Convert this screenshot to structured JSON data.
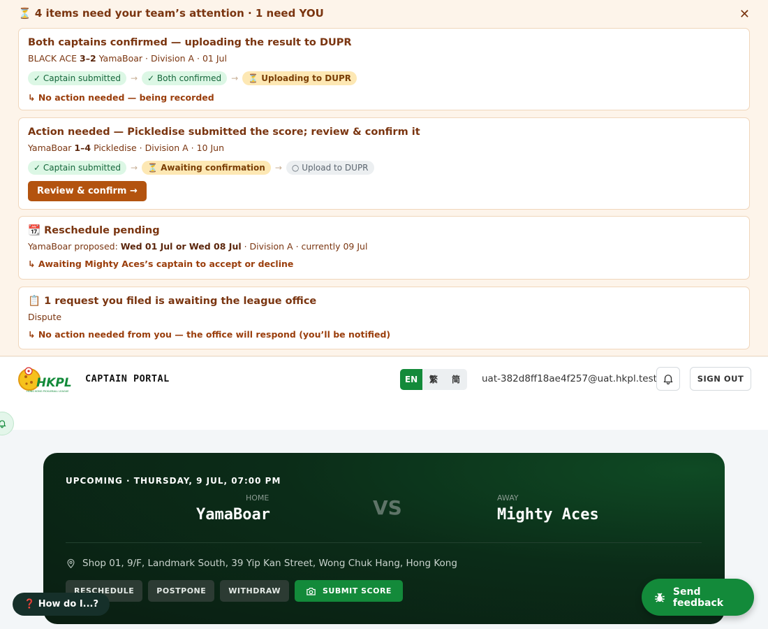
{
  "attention": {
    "headline": "⏳ 4 items need your team’s attention · 1 need YOU",
    "close_glyph": "✕",
    "cards": [
      {
        "title": "Both captains confirmed — uploading the result to DUPR",
        "home": "BLACK ACE",
        "score": "3–2",
        "away": "YamaBoar",
        "meta": " · Division A · 01 Jul",
        "steps": [
          "✓ Captain submitted",
          "✓ Both confirmed",
          "⏳ Uploading to DUPR"
        ],
        "note": "↳ No action needed — being recorded"
      },
      {
        "title": "Action needed — Pickledise submitted the score; review & confirm it",
        "home": "YamaBoar",
        "score": "1–4",
        "away": "Pickledise",
        "meta": " · Division A · 10 Jun",
        "steps": [
          "✓ Captain submitted",
          "⏳ Awaiting confirmation",
          "○ Upload to DUPR"
        ],
        "button": "Review & confirm →"
      },
      {
        "title": "📆 Reschedule pending",
        "proposer": "YamaBoar proposed: ",
        "proposed_dates": "Wed 01 Jul or Wed 08 Jul",
        "meta": " · Division A · currently 09 Jul",
        "note": "↳ Awaiting Mighty Aces’s captain to accept or decline"
      },
      {
        "title": "📋 1 request you filed is awaiting the league office",
        "sub": "Dispute",
        "note": "↳ No action needed from you — the office will respond (you’ll be notified)"
      }
    ],
    "arrow": "→"
  },
  "header": {
    "logo_text": "HKPL",
    "logo_subtext": "HONG KONG PICKLEBALL LEAGUE",
    "portal_label": "CAPTAIN PORTAL",
    "languages": [
      "EN",
      "繁",
      "简"
    ],
    "active_language": "EN",
    "email": "uat-382d8ff18ae4f257@uat.hkpl.test",
    "sign_out": "SIGN OUT"
  },
  "match": {
    "status": "UPCOMING · THURSDAY, 9 JUL, 07:00 PM",
    "home_label": "HOME",
    "home_team": "YamaBoar",
    "vs": "VS",
    "away_label": "AWAY",
    "away_team": "Mighty Aces",
    "venue": "Shop 01, 9/F, Landmark South, 39 Yip Kan Street, Wong Chuk Hang, Hong Kong",
    "actions": [
      "RESCHEDULE",
      "POSTPONE",
      "WITHDRAW"
    ],
    "submit_score": "SUBMIT SCORE"
  },
  "help_button": "❓ How do I...?",
  "feedback_button": "Send feedback",
  "colors": {
    "accent_green": "#138a3a",
    "attention_brown": "#7a3510",
    "review_button": "#b3530f"
  },
  "icons": [
    "close-icon",
    "bell-icon",
    "location-pin-icon",
    "camera-icon",
    "bug-icon"
  ]
}
